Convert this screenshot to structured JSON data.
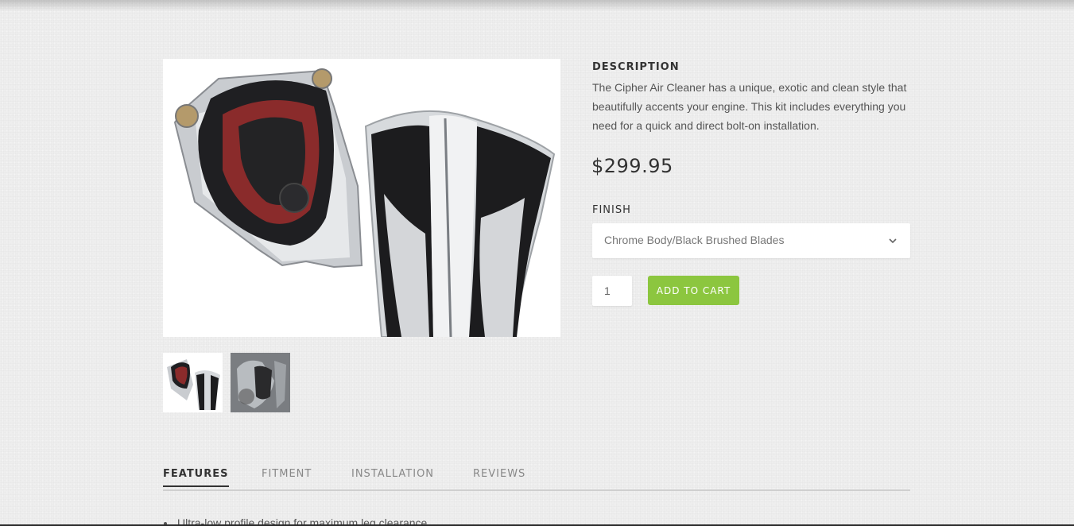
{
  "product": {
    "description_title": "DESCRIPTION",
    "description_text": "The Cipher Air Cleaner has a unique, exotic and clean style that beautifully accents your engine. This kit includes everything you need for a quick and direct bolt-on installation.",
    "price": "$299.95",
    "finish_label": "FINISH",
    "finish_selected": "Chrome Body/Black Brushed Blades",
    "quantity": "1",
    "add_to_cart_label": "ADD TO CART"
  },
  "tabs": [
    {
      "label": "FEATURES",
      "active": true
    },
    {
      "label": "FITMENT",
      "active": false
    },
    {
      "label": "INSTALLATION",
      "active": false
    },
    {
      "label": "REVIEWS",
      "active": false
    }
  ],
  "features": [
    "Ultra-low profile design for maximum leg clearance"
  ],
  "colors": {
    "accent": "#8cc63f",
    "background": "#eeeeee",
    "text": "#555555"
  },
  "icons": {
    "select_chevron": "chevron-down-icon"
  }
}
